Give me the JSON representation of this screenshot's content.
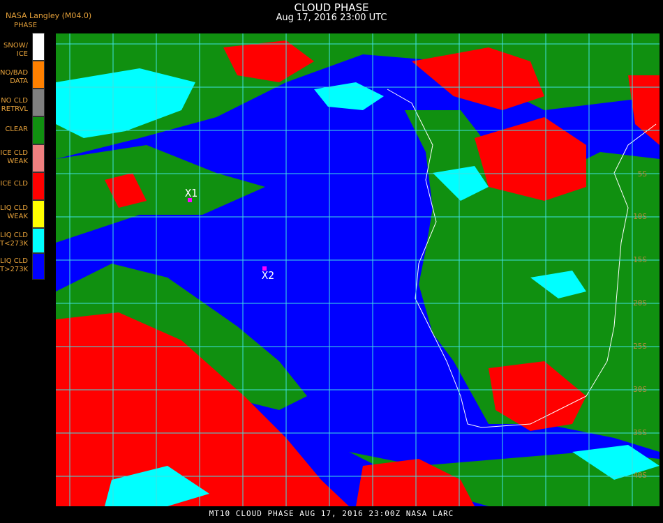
{
  "header": {
    "producer": "NASA Langley (M04.0)",
    "title": "CLOUD PHASE",
    "subtitle": "Aug 17, 2016 23:00 UTC"
  },
  "legend": {
    "title": "PHASE",
    "items": [
      {
        "label": "SNOW/ ICE",
        "color": "#ffffff"
      },
      {
        "label": "NO/BAD DATA",
        "color": "#ff8000"
      },
      {
        "label": "NO CLD RETRVL",
        "color": "#808080"
      },
      {
        "label": "CLEAR",
        "color": "#109010"
      },
      {
        "label": "ICE CLD WEAK",
        "color": "#f08080"
      },
      {
        "label": "ICE CLD",
        "color": "#ff0000"
      },
      {
        "label": "LIQ CLD WEAK",
        "color": "#ffff00"
      },
      {
        "label": "LIQ CLD T<273K",
        "color": "#00ffff"
      },
      {
        "label": "LIQ CLD T>273K",
        "color": "#0000ff"
      }
    ]
  },
  "map": {
    "markers": [
      {
        "label": "X1"
      },
      {
        "label": "X2"
      }
    ],
    "lat_labels": [
      "5S",
      "10S",
      "15S",
      "20S",
      "25S",
      "30S",
      "35S",
      "40S"
    ],
    "grid_color": "#40e0e0"
  },
  "footer": {
    "text": "MT10  CLOUD PHASE   AUG 17, 2016 23:00Z   NASA LARC"
  }
}
